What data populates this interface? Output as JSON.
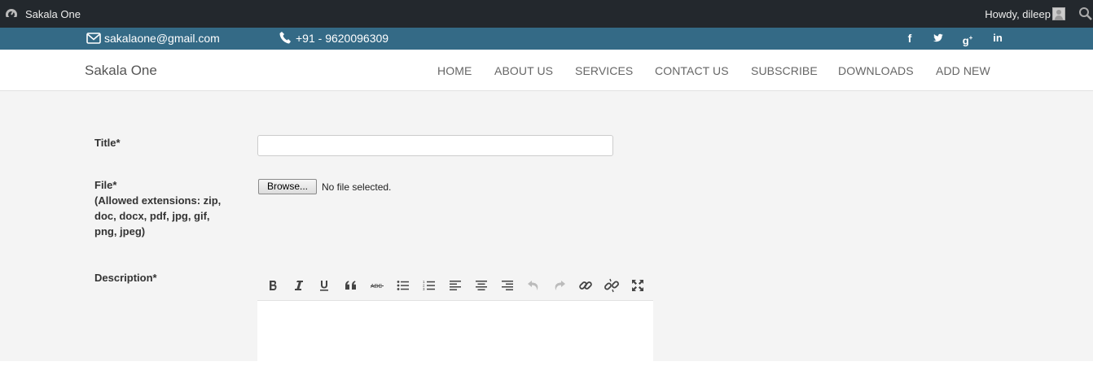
{
  "admin_bar": {
    "site_name": "Sakala One",
    "howdy": "Howdy, dileep"
  },
  "top_bar": {
    "email": "sakalaone@gmail.com",
    "phone": "+91 - 9620096309",
    "social": [
      "facebook-icon",
      "twitter-icon",
      "google-plus-icon",
      "linkedin-icon"
    ]
  },
  "navbar": {
    "brand": "Sakala One",
    "items": [
      "HOME",
      "ABOUT US",
      "SERVICES",
      "CONTACT US",
      "SUBSCRIBE",
      "DOWNLOADS",
      "ADD NEW"
    ]
  },
  "form": {
    "title_label": "Title*",
    "title_value": "",
    "file_label": "File*",
    "file_extensions": "(Allowed extensions: zip, doc, docx, pdf, jpg, gif, png, jpeg)",
    "browse_label": "Browse...",
    "file_status": "No file selected.",
    "description_label": "Description*",
    "editor_tools": [
      "bold-icon",
      "italic-icon",
      "underline-icon",
      "blockquote-icon",
      "strikethrough-icon",
      "bullet-list-icon",
      "numbered-list-icon",
      "align-left-icon",
      "align-center-icon",
      "align-right-icon",
      "undo-icon",
      "redo-icon",
      "link-icon",
      "unlink-icon",
      "fullscreen-icon"
    ]
  },
  "colors": {
    "admin_bar": "#23282d",
    "top_bar": "#346a86",
    "content_bg": "#f4f4f4"
  }
}
